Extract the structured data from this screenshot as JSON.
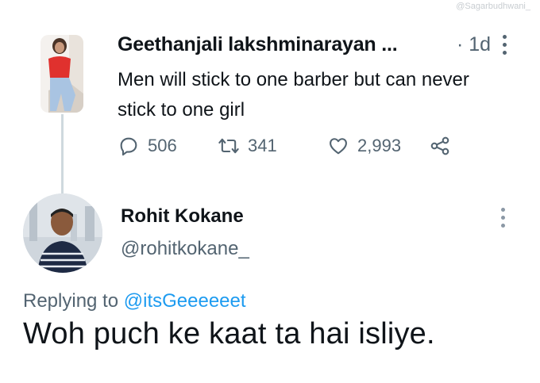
{
  "watermark": "@Sagarbudhwani_",
  "tweet1": {
    "author_name": "Geethanjali lakshminarayan ...",
    "time": "· 1d",
    "text": "Men will stick to one barber but can never stick to one girl",
    "actions": {
      "replies": "506",
      "retweets": "341",
      "likes": "2,993"
    },
    "icons": [
      "reply-icon",
      "retweet-icon",
      "like-icon",
      "share-icon",
      "more-icon"
    ]
  },
  "tweet2": {
    "author_name": "Rohit Kokane",
    "handle": "@rohitkokane_",
    "replying_prefix": "Replying to",
    "replying_to": "@itsGeeeeeet",
    "text": "Woh puch ke kaat ta hai isliye."
  },
  "colors": {
    "text": "#0f1419",
    "secondary": "#536471",
    "link": "#1d9bf0",
    "thread_line": "#cfd9de"
  }
}
